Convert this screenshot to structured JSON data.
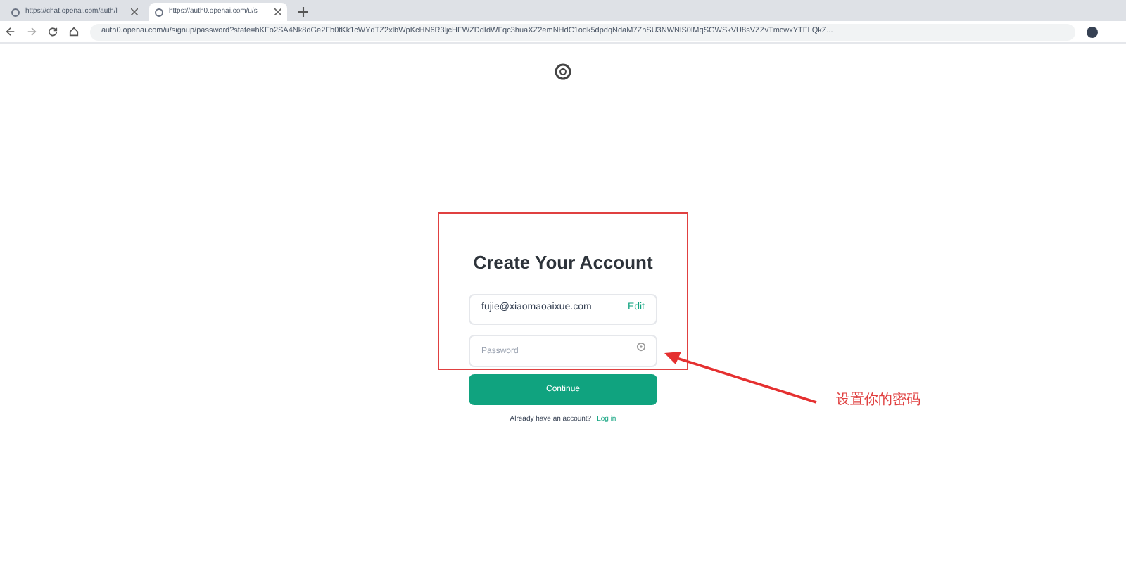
{
  "browser": {
    "tabs": [
      {
        "title": "https://chat.openai.com/auth/l",
        "selected": false
      },
      {
        "title": "https://auth0.openai.com/u/s",
        "selected": true
      }
    ],
    "address": "auth0.openai.com/u/signup/password?state=hKFo2SA4Nk8dGe2Fb0tKk1cWYdTZ2xlbWpKcHN6R3ljcHFWZDdIdWFqc3huaXZ2emNHdC1odk5dpdqNdaM7ZhSU3NWNlS0lMqSGWSkVU8sVZZvTmcwxYTFLQkZ..."
  },
  "form": {
    "title": "Create Your Account",
    "email": "fujie@xiaomaoaixue.com",
    "edit_link": "Edit",
    "password_placeholder": "Password",
    "button": "Continue",
    "prompt": "Already have an account?",
    "login_link": "Log in"
  },
  "annotation": {
    "text": "设置你的密码"
  }
}
